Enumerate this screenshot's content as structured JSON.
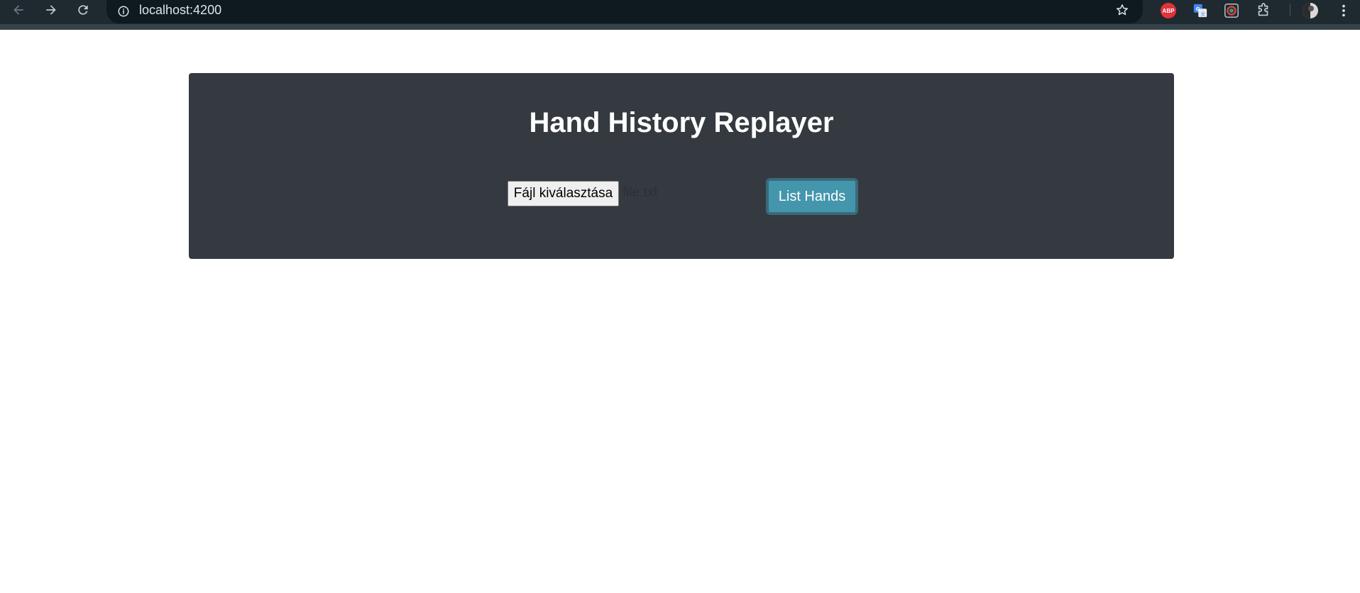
{
  "browser": {
    "url": "localhost:4200",
    "icons": {
      "back": "arrow-left-icon",
      "forward": "arrow-right-icon",
      "reload": "reload-icon",
      "info": "info-icon",
      "bookmark": "star-icon",
      "adblock": "adblock-icon",
      "translate": "translate-icon",
      "color_picker": "color-picker-icon",
      "extensions": "puzzle-icon",
      "profile": "avatar",
      "menu": "more-vert-icon"
    },
    "adblock_label": "ABP",
    "colors": {
      "chrome_bg": "#1f2a30",
      "omnibox_bg": "#0f1a20"
    }
  },
  "app": {
    "title": "Hand History Replayer",
    "file_button_label": "Fájl kiválasztása",
    "file_name": "file.txt",
    "list_button_label": "List Hands",
    "colors": {
      "panel_bg": "#343a40",
      "button_bg": "#4496ad",
      "button_border": "#3a6a7c",
      "text": "#ffffff"
    }
  }
}
